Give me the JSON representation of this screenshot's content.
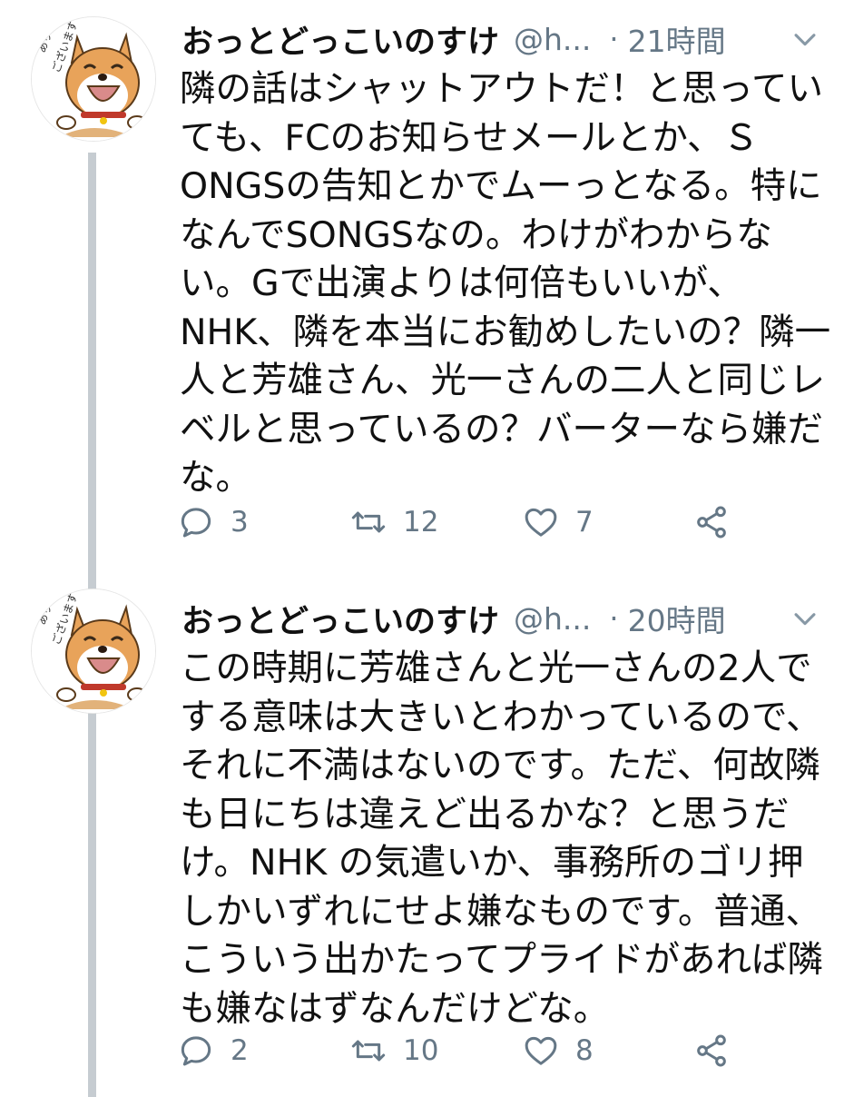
{
  "tweets": [
    {
      "display_name": "おっとどっこいのすけ",
      "handle": "@h...",
      "separator": "·",
      "time": "21時間",
      "avatar_text": "ありがとうございます",
      "lines": [
        "隣の話はシャットアウトだ！と思ってい",
        "ても、FCのお知らせメールとか、Ｓ",
        "ONGSの告知とかでムーっとなる。特に",
        "なんでSONGSなの。わけがわからな",
        "い。Gで出演よりは何倍もいいが、",
        "NHK、隣を本当にお勧めしたいの？隣一",
        "人と芳雄さん、光一さんの二人と同じレ",
        "ベルと思っているの？バーターなら嫌だ",
        "な。"
      ],
      "actions": {
        "replies": "3",
        "retweets": "12",
        "likes": "7"
      },
      "icons": [
        "reply-icon",
        "retweet-icon",
        "like-icon",
        "share-icon",
        "chevron-down-icon"
      ]
    },
    {
      "display_name": "おっとどっこいのすけ",
      "handle": "@h...",
      "separator": "·",
      "time": "20時間",
      "avatar_text": "ありがとうございます",
      "lines": [
        "この時期に芳雄さんと光一さんの2人で",
        "する意味は大きいとわかっているので、",
        "それに不満はないのです。ただ、何故隣",
        "も日にちは違えど出るかな？と思うだ",
        "け。NHK の気遣いか、事務所のゴリ押",
        "しかいずれにせよ嫌なものです。普通、",
        "こういう出かたってプライドがあれば隣",
        "も嫌なはずなんだけどな。"
      ],
      "actions": {
        "replies": "2",
        "retweets": "10",
        "likes": "8"
      },
      "icons": [
        "reply-icon",
        "retweet-icon",
        "like-icon",
        "share-icon",
        "chevron-down-icon"
      ]
    }
  ],
  "colors": {
    "text": "#111111",
    "muted": "#657786",
    "thread_line": "#c6ccd1",
    "avatar_dog": "#e8a35a",
    "avatar_collar": "#c0392b"
  }
}
